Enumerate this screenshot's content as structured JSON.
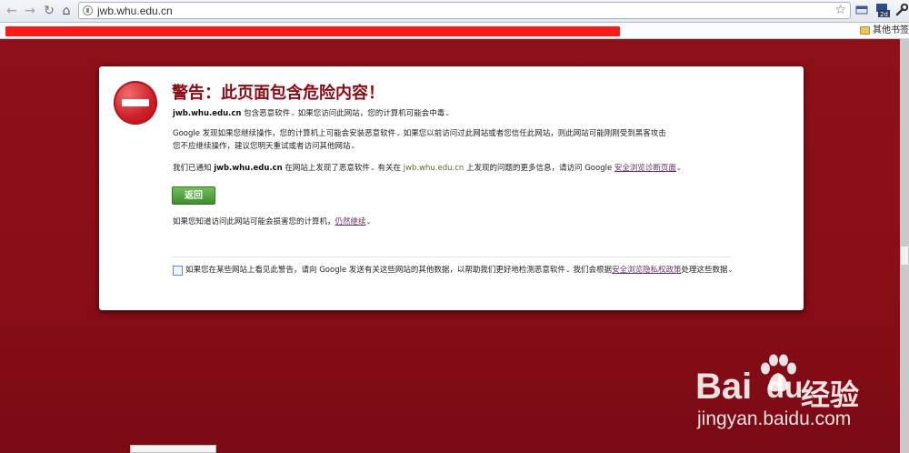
{
  "browser": {
    "url": "jwb.whu.edu.cn",
    "other_bookmarks": "其他书签",
    "ext_badge": "2d"
  },
  "warning": {
    "title": "警告：此页面包含危险内容！",
    "para1": {
      "site": "jwb.whu.edu.cn",
      "text": " 包含恶意软件",
      "text2": " 如果您访问此网站，您的计算机可能会中毒"
    },
    "para2": {
      "text_a": "Google 发现如果您继续操作，您的计算机上可能会安装恶意软件",
      "text_b": " 如果您以前访问过此网站或者您信任此网站，则此网站可能刚刚受到黑客攻击",
      "text_c": " 您不应继续操作，建议您明天重试或者访问其他网站"
    },
    "para3": {
      "text_a": "我们已通知 ",
      "site": "jwb.whu.edu.cn",
      "text_b": " 在网站上发现了恶意软件",
      "text_c": " 有关在 ",
      "site2": "jwb.whu.edu.cn",
      "text_d": " 上发现的问题的更多信息，请访问 Google ",
      "link": "安全浏览诊断页面"
    },
    "back_button": "返回",
    "proceed": {
      "text": "如果您知道访问此网站可能会损害您的计算机，",
      "link": "仍然继续"
    },
    "report": {
      "text_a": "如果您在某些网站上看见此警告，请向 Google 发送有关这些网站的其他数据，以帮助我们更好地检测恶意软件",
      "text_b": " 我们会根据",
      "link": "安全浏览隐私权政策",
      "text_c": "处理这些数据"
    }
  },
  "watermark": {
    "brand": "Bai",
    "brand_suffix": "经验",
    "url": "jingyan.baidu.com"
  },
  "colors": {
    "page_bg": "#8c0f1c",
    "title": "#8b0a14",
    "button": "#4fa33c",
    "link": "#662f6a"
  }
}
